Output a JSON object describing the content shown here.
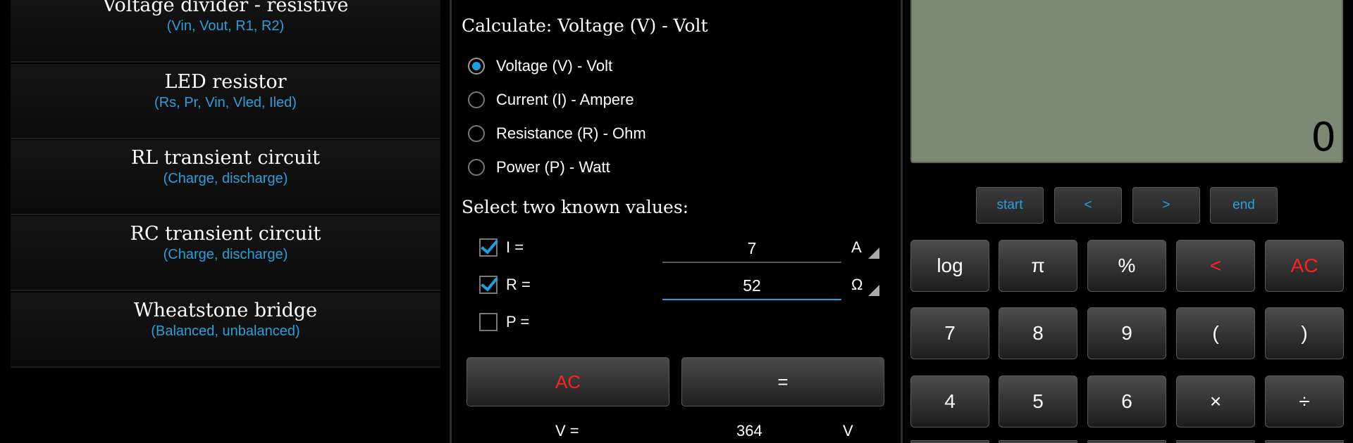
{
  "list": {
    "items": [
      {
        "title": "Voltage divider - resistive",
        "subtitle": "(Vin, Vout, R1, R2)"
      },
      {
        "title": "LED resistor",
        "subtitle": "(Rs, Pr, Vin, Vled, Iled)"
      },
      {
        "title": "RL transient circuit",
        "subtitle": "(Charge, discharge)"
      },
      {
        "title": "RC transient circuit",
        "subtitle": "(Charge, discharge)"
      },
      {
        "title": "Wheatstone bridge",
        "subtitle": "(Balanced, unbalanced)"
      }
    ]
  },
  "form": {
    "calculate_heading": "Calculate: Voltage (V) - Volt",
    "radios": [
      {
        "label": "Voltage (V) - Volt",
        "checked": true
      },
      {
        "label": "Current (I) - Ampere",
        "checked": false
      },
      {
        "label": "Resistance (R) - Ohm",
        "checked": false
      },
      {
        "label": "Power (P) - Watt",
        "checked": false
      }
    ],
    "known_heading": "Select two known values:",
    "inputs": [
      {
        "label": "I =",
        "checked": true,
        "value": "7",
        "unit": "A"
      },
      {
        "label": "R =",
        "checked": true,
        "value": "52",
        "unit": "Ω"
      },
      {
        "label": "P =",
        "checked": false
      }
    ],
    "ac_label": "AC",
    "equals_label": "=",
    "result": {
      "label": "V =",
      "value": "364",
      "unit": "V"
    }
  },
  "calculator": {
    "display": "0",
    "nav": [
      "start",
      "<",
      ">",
      "end"
    ],
    "rows": [
      [
        "log",
        "π",
        "%",
        "<",
        "AC"
      ],
      [
        "7",
        "8",
        "9",
        "(",
        ")"
      ],
      [
        "4",
        "5",
        "6",
        "×",
        "÷"
      ]
    ]
  },
  "colors": {
    "accent": "#1ea0e0",
    "subtitle": "#2a9fd8",
    "danger": "#ff2020",
    "lcd": "#7d8a73"
  }
}
